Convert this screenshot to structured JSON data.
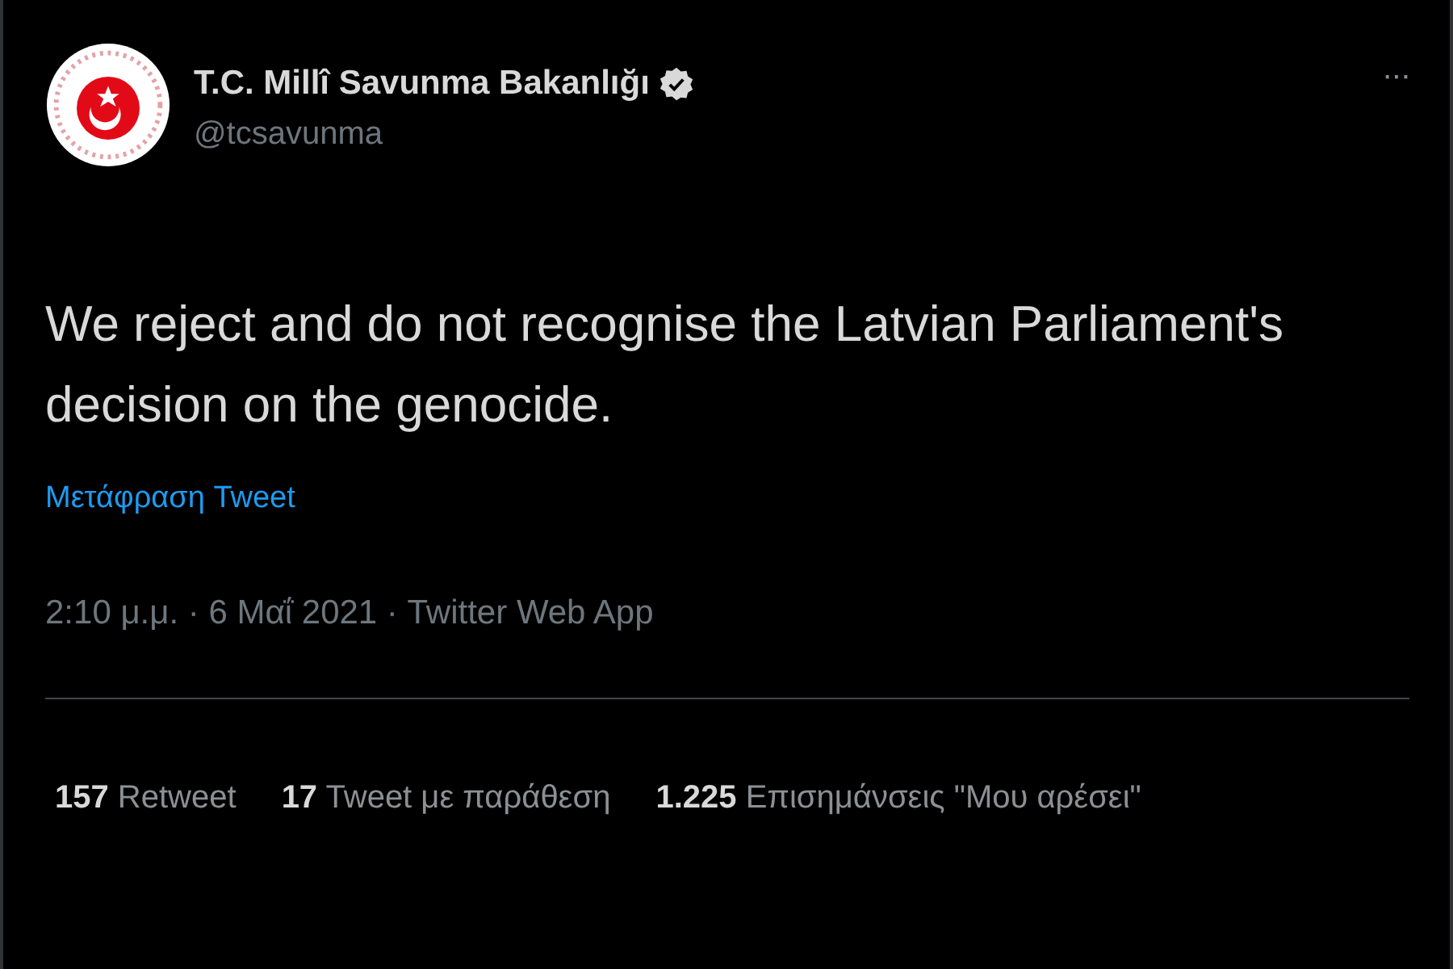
{
  "author": {
    "name": "T.C. Millî Savunma Bakanlığı",
    "verified": true,
    "handle": "@tcsavunma"
  },
  "more_menu": "···",
  "tweet": {
    "text": "We reject and do not recognise the Latvian Parliament's decision on the genocide."
  },
  "translate_link": "Μετάφραση Tweet",
  "meta": "2:10 μ.μ. · 6 Μαΐ 2021 · Twitter Web App",
  "stats": [
    {
      "count": "157",
      "label": "Retweet"
    },
    {
      "count": "17",
      "label": "Tweet με παράθεση"
    },
    {
      "count": "1.225",
      "label": "Επισημάνσεις \"Μου αρέσει\""
    }
  ]
}
